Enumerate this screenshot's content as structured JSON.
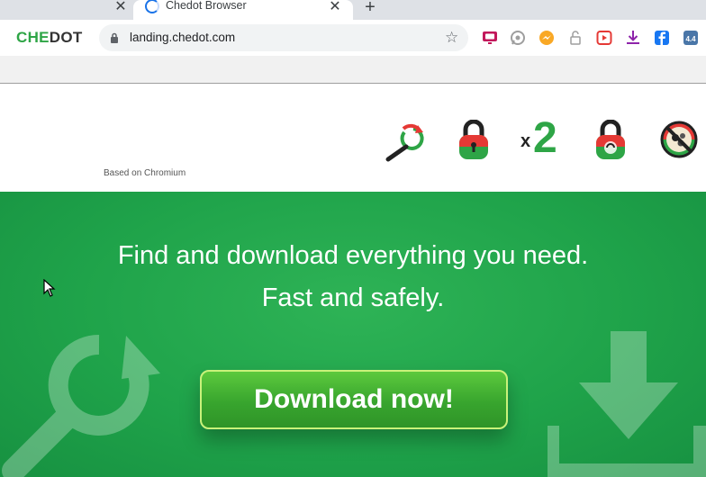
{
  "browser": {
    "tab_title": "Chedot Browser",
    "close_glyph": "✕",
    "new_tab_glyph": "+",
    "url": "landing.chedot.com",
    "star_glyph": "☆",
    "logo_part1": "CHE",
    "logo_part2": "DOT",
    "accent": "#1a73e8"
  },
  "extensions": [
    {
      "name": "tv-icon",
      "color": "#c2185b"
    },
    {
      "name": "whatsapp-icon",
      "color": "#9e9e9e"
    },
    {
      "name": "messenger-icon",
      "color": "#f9a825"
    },
    {
      "name": "lock-open-icon",
      "color": "#9e9e9e"
    },
    {
      "name": "video-icon",
      "color": "#e53935"
    },
    {
      "name": "download-icon",
      "color": "#8e24aa"
    },
    {
      "name": "facebook-icon",
      "color": "#1877f2"
    },
    {
      "name": "vk-icon",
      "color": "#4a76a8"
    }
  ],
  "page": {
    "based_on": "Based on Chromium",
    "x2_x": "x",
    "x2_num": "2",
    "headline_line1": "Find and download everything you need.",
    "headline_line2": "Fast and safely.",
    "download_label": "Download now!",
    "brand_green": "#1fa34a"
  }
}
